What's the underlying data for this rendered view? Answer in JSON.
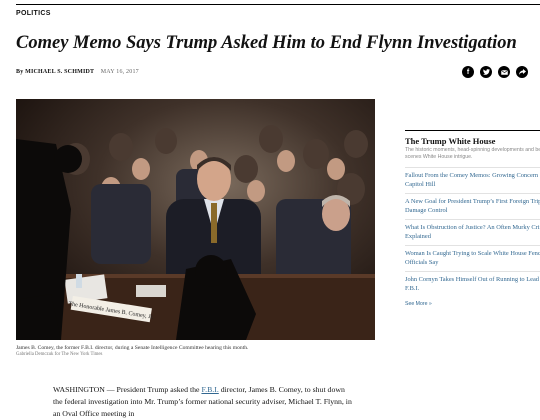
{
  "section": "POLITICS",
  "headline": "Comey Memo Says Trump Asked Him to End Flynn Investigation",
  "byline": {
    "author": "By MICHAEL S. SCHMIDT",
    "date": "MAY 16, 2017"
  },
  "share_icons": [
    "facebook-icon",
    "twitter-icon",
    "email-icon",
    "share-icon"
  ],
  "photo": {
    "nameplate_text": "The Honorable James B. Comey, Jr.",
    "caption": "James B. Comey, the former F.B.I. director, during a Senate Intelligence Committee hearing this month.",
    "credit": "Gabriella Demczuk for The New York Times"
  },
  "article": {
    "lead_before": "WASHINGTON — President Trump asked the ",
    "link": "F.B.I.",
    "lead_after": " director, James B. Comey, to shut down the federal investigation into Mr. Trump’s former national security adviser, Michael T. Flynn, in an Oval Office meeting in"
  },
  "rail": {
    "title": "The Trump White House",
    "description": "The historic moments, head-spinning developments and behind-the-scenes White House intrigue.",
    "items": [
      "Fallout From the Comey Memos: Growing Concern on Capitol Hill",
      "A New Goal for President Trump’s First Foreign Trip: Damage Control",
      "What Is Obstruction of Justice? An Often Murky Crime, Explained",
      "Woman Is Caught Trying to Scale White House Fence, Officials Say",
      "John Cornyn Takes Himself Out of Running to Lead the F.B.I."
    ],
    "see_more": "See More »"
  },
  "colors": {
    "link": "#326891",
    "text": "#121212",
    "photo_bg": "#2a1d18"
  }
}
